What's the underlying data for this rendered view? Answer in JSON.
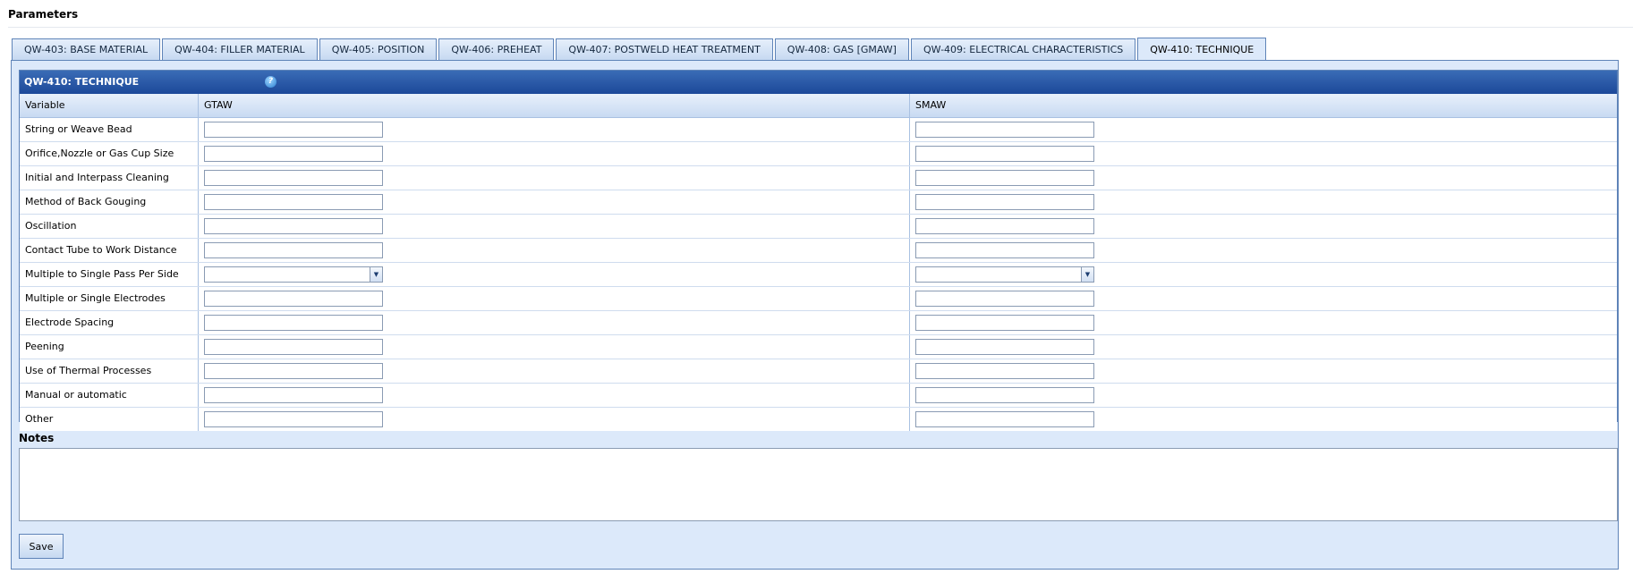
{
  "page": {
    "title": "Parameters"
  },
  "tabs": [
    {
      "label": "QW-403: BASE MATERIAL",
      "active": false
    },
    {
      "label": "QW-404: FILLER MATERIAL",
      "active": false
    },
    {
      "label": "QW-405: POSITION",
      "active": false
    },
    {
      "label": "QW-406: PREHEAT",
      "active": false
    },
    {
      "label": "QW-407: POSTWELD HEAT TREATMENT",
      "active": false
    },
    {
      "label": "QW-408: GAS [GMAW]",
      "active": false
    },
    {
      "label": "QW-409: ELECTRICAL CHARACTERISTICS",
      "active": false
    },
    {
      "label": "QW-410: TECHNIQUE",
      "active": true
    }
  ],
  "section": {
    "title": "QW-410: TECHNIQUE",
    "help_icon": "question-mark-icon",
    "columns": {
      "variable": "Variable",
      "gtaw": "GTAW",
      "smaw": "SMAW"
    },
    "rows": [
      {
        "label": "String or Weave Bead",
        "type": "text",
        "gtaw": "",
        "smaw": ""
      },
      {
        "label": "Orifice,Nozzle or Gas Cup Size",
        "type": "text",
        "gtaw": "",
        "smaw": ""
      },
      {
        "label": "Initial and Interpass Cleaning",
        "type": "text",
        "gtaw": "",
        "smaw": ""
      },
      {
        "label": "Method of Back Gouging",
        "type": "text",
        "gtaw": "",
        "smaw": ""
      },
      {
        "label": "Oscillation",
        "type": "text",
        "gtaw": "",
        "smaw": ""
      },
      {
        "label": "Contact Tube to Work Distance",
        "type": "text",
        "gtaw": "",
        "smaw": ""
      },
      {
        "label": "Multiple to Single Pass Per Side",
        "type": "select",
        "gtaw": "",
        "smaw": ""
      },
      {
        "label": "Multiple or Single Electrodes",
        "type": "text",
        "gtaw": "",
        "smaw": ""
      },
      {
        "label": "Electrode Spacing",
        "type": "text",
        "gtaw": "",
        "smaw": ""
      },
      {
        "label": "Peening",
        "type": "text",
        "gtaw": "",
        "smaw": ""
      },
      {
        "label": "Use of Thermal Processes",
        "type": "text",
        "gtaw": "",
        "smaw": ""
      },
      {
        "label": "Manual or automatic",
        "type": "text",
        "gtaw": "",
        "smaw": ""
      },
      {
        "label": "Other",
        "type": "text",
        "gtaw": "",
        "smaw": ""
      }
    ]
  },
  "notes": {
    "label": "Notes",
    "value": ""
  },
  "actions": {
    "save_label": "Save"
  },
  "colors": {
    "header_blue": "#1c4899",
    "panel_bg": "#dce9fa",
    "border_blue": "#5f84b8"
  }
}
